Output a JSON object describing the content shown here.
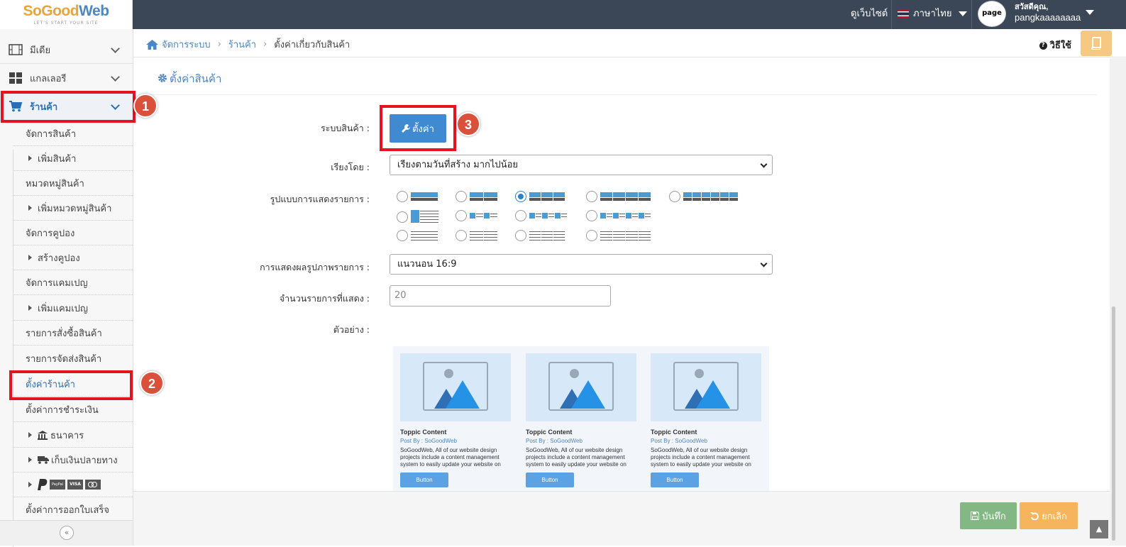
{
  "brand": {
    "name_a": "SoGood",
    "name_b": "Web",
    "tagline": "LET'S START YOUR SITE"
  },
  "topbar": {
    "view_site": "ดูเว็บไซต์",
    "language": "ภาษาไทย",
    "avatar_text": "page",
    "greeting": "สวัสดีคุณ,",
    "username": "pangkaaaaaaaa"
  },
  "sidebar": {
    "media": "มีเดีย",
    "gallery": "แกลเลอรี",
    "shop": "ร้านค้า",
    "items": [
      {
        "label": "จัดการสินค้า"
      },
      {
        "label": "เพิ่มสินค้า"
      },
      {
        "label": "หมวดหมู่สินค้า"
      },
      {
        "label": "เพิ่มหมวดหมู่สินค้า"
      },
      {
        "label": "จัดการคูปอง"
      },
      {
        "label": "สร้างคูปอง"
      },
      {
        "label": "จัดการแคมเปญ"
      },
      {
        "label": "เพิ่มแคมเปญ"
      },
      {
        "label": "รายการสั่งซื้อสินค้า"
      },
      {
        "label": "รายการจัดส่งสินค้า"
      },
      {
        "label": "ตั้งค่าร้านค้า"
      },
      {
        "label": "ตั้งค่าการชำระเงิน"
      },
      {
        "label": "ธนาคาร"
      },
      {
        "label": "เก็บเงินปลายทาง"
      },
      {
        "label": ""
      },
      {
        "label": "ตั้งค่าการออกใบเสร็จ"
      }
    ],
    "payment_logos": [
      "PayPal",
      "VISA",
      "MC"
    ]
  },
  "breadcrumb": {
    "home": "จัดการระบบ",
    "shop": "ร้านค้า",
    "current": "ตั้งค่าเกี่ยวกับสินค้า"
  },
  "help_label": "วิธีใช้",
  "page": {
    "title": "ตั้งค่าสินค้า",
    "product_system_label": "ระบบสินค้า :",
    "settings_button": "ตั้งค่า",
    "sort_label": "เรียงโดย :",
    "sort_value": "เรียงตามวันที่สร้าง มากไปน้อย",
    "layout_label": "รูปแบบการแสดงรายการ :",
    "layout_selected": "3-columns",
    "image_display_label": "การแสดงผลรูปภาพรายการ :",
    "image_display_value": "แนวนอน 16:9",
    "items_count_label": "จำนวนรายการที่แสดง :",
    "items_count_value": "20",
    "preview_label": "ตัวอย่าง :"
  },
  "preview_cards": [
    {
      "title": "Toppic Content",
      "by": "Post By : SoGoodWeb",
      "desc": "SoGoodWeb, All of our website design projects include a content management system to easily update your website on",
      "button": "Button"
    },
    {
      "title": "Toppic Content",
      "by": "Post By : SoGoodWeb",
      "desc": "SoGoodWeb, All of our website design projects include a content management system to easily update your website on",
      "button": "Button"
    },
    {
      "title": "Toppic Content",
      "by": "Post By : SoGoodWeb",
      "desc": "SoGoodWeb, All of our website design projects include a content management system to easily update your website on",
      "button": "Button"
    }
  ],
  "footer": {
    "save": "บันทึก",
    "cancel": "ยกเลิก"
  },
  "annotations": [
    "1",
    "2",
    "3"
  ],
  "colors": {
    "accent": "#4b86c5",
    "topbar": "#3b4757",
    "highlight": "#e3141c",
    "badge": "#d9513a",
    "save": "#83b784",
    "cancel": "#f6b45c"
  }
}
